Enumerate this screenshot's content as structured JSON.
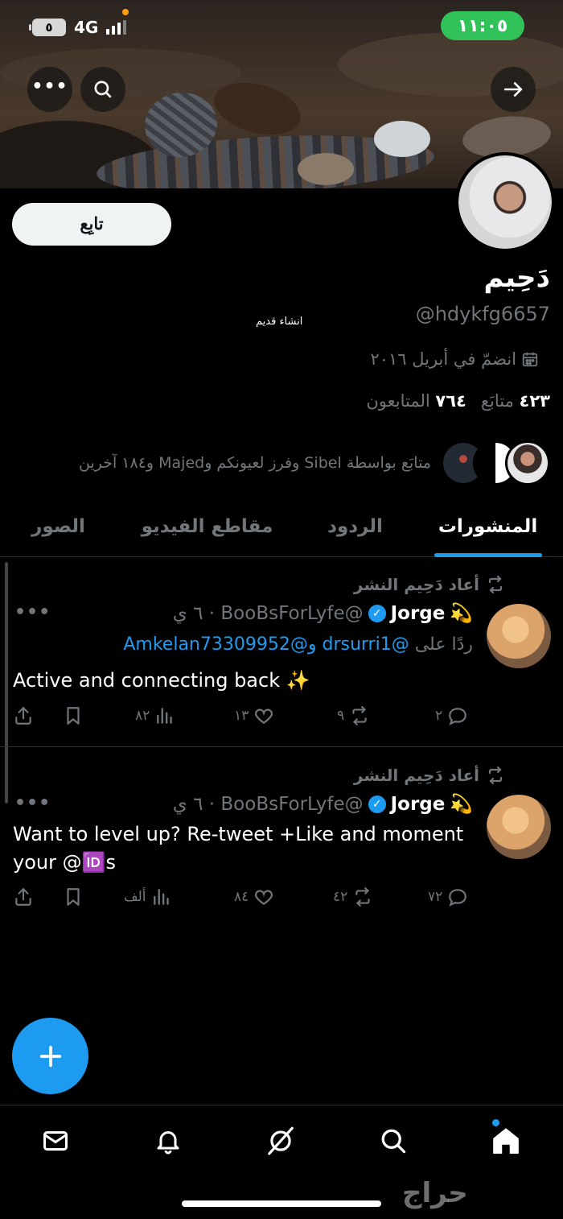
{
  "status_bar": {
    "time": "١١:٠٥",
    "battery": "٥",
    "network": "4G"
  },
  "profile": {
    "follow_label": "تابِع",
    "display_name": "دَحِيم",
    "handle": "@hdykfg6657",
    "bio": "انشاء قديم",
    "joined": "انضمّ في أبريل ٢٠١٦",
    "following_count": "٤٢٣",
    "following_label": "متابَع",
    "followers_count": "٧٦٤",
    "followers_label": "المتابعون",
    "followed_by": "متابَع بواسطة Sibel وفرز لعيونكم وMajed و١٨٤ آخرين"
  },
  "tabs": [
    {
      "label": "المنشورات",
      "active": true
    },
    {
      "label": "الردود",
      "active": false
    },
    {
      "label": "مقاطع الفيديو",
      "active": false
    },
    {
      "label": "الصور",
      "active": false
    }
  ],
  "posts": [
    {
      "repost_label": "أعاد دَحِيم النشر",
      "author": "Jorge",
      "emoji": "💫",
      "meta": "@BooBsForLyfe · ٦ ي",
      "reply_prefix": "ردًا على",
      "reply_mentions": "@drsurri1 و@Amkelan73309952",
      "text": "Active and connecting back ✨",
      "replies": "٢",
      "reposts": "٩",
      "likes": "١٣",
      "views": "٨٢"
    },
    {
      "repost_label": "أعاد دَحِيم النشر",
      "author": "Jorge",
      "emoji": "💫",
      "meta": "@BooBsForLyfe · ٦ ي",
      "text": "Want to level up?  Re-tweet +Like and moment your @🆔s",
      "replies": "٧٢",
      "reposts": "٤٢",
      "likes": "٨٤",
      "views": "ألف"
    }
  ],
  "watermark": "حراج",
  "colors": {
    "accent": "#1d9bf0",
    "status_pill": "#31c25a",
    "background": "#000000",
    "muted": "#71767b"
  }
}
